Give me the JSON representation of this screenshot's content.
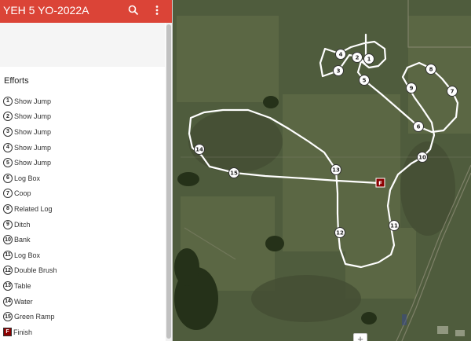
{
  "app_bar": {
    "title": "YEH 5 YO-2022A",
    "search_icon": "search-icon",
    "more_icon": "more-vert-icon",
    "color": "#db4437"
  },
  "sidebar": {
    "section_title": "Efforts",
    "items": [
      {
        "badge": "1",
        "label": "Show Jump"
      },
      {
        "badge": "2",
        "label": "Show Jump"
      },
      {
        "badge": "3",
        "label": "Show Jump"
      },
      {
        "badge": "4",
        "label": "Show Jump"
      },
      {
        "badge": "5",
        "label": "Show Jump"
      },
      {
        "badge": "6",
        "label": "Log Box"
      },
      {
        "badge": "7",
        "label": "Coop"
      },
      {
        "badge": "8",
        "label": "Related Log"
      },
      {
        "badge": "9",
        "label": "Ditch"
      },
      {
        "badge": "10",
        "label": "Bank"
      },
      {
        "badge": "11",
        "label": "Log Box"
      },
      {
        "badge": "12",
        "label": "Double Brush"
      },
      {
        "badge": "13",
        "label": "Table"
      },
      {
        "badge": "14",
        "label": "Water"
      },
      {
        "badge": "15",
        "label": "Green Ramp"
      },
      {
        "badge": "F",
        "label": "Finish"
      }
    ]
  },
  "map": {
    "finish_marker": "F",
    "finish_color": "#8b0000",
    "route_color": "#ffffff",
    "zoom_in_label": "+"
  }
}
